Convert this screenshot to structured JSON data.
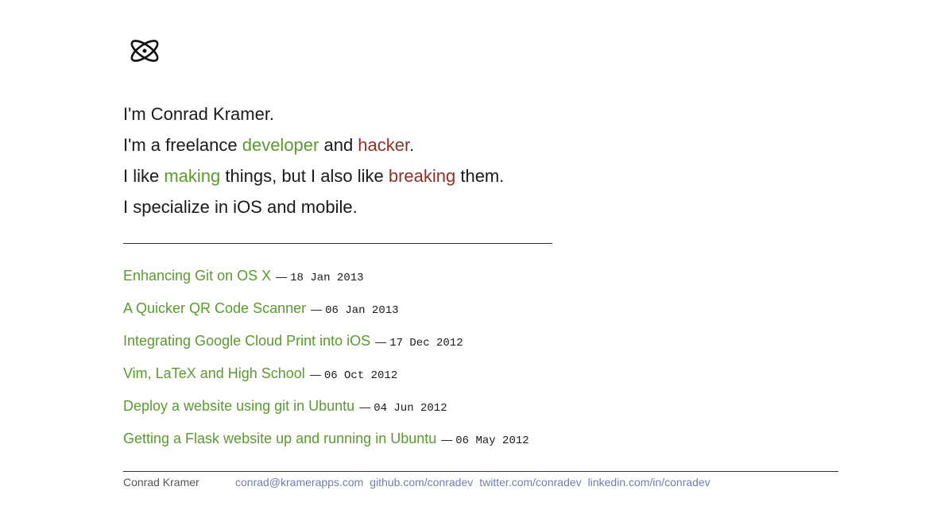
{
  "logo": {
    "icon": "atom-icon"
  },
  "intro": {
    "line1": "I'm Conrad Kramer.",
    "line2": {
      "prefix": "I'm a freelance ",
      "word1": "developer",
      "middle": " and ",
      "word2": "hacker",
      "suffix": "."
    },
    "line3": {
      "prefix": "I like ",
      "word1": "making",
      "middle": " things, but I also like ",
      "word2": "breaking",
      "suffix": " them."
    },
    "line4": "I specialize in iOS and mobile."
  },
  "posts": [
    {
      "title": "Enhancing Git on OS X",
      "sep": "—",
      "date": "18 Jan 2013"
    },
    {
      "title": "A Quicker QR Code Scanner",
      "sep": "—",
      "date": "06 Jan 2013"
    },
    {
      "title": "Integrating Google Cloud Print into iOS",
      "sep": "—",
      "date": "17 Dec 2012"
    },
    {
      "title": "Vim, LaTeX and High School",
      "sep": "—",
      "date": "06 Oct 2012"
    },
    {
      "title": "Deploy a website using git in Ubuntu",
      "sep": "—",
      "date": "04 Jun 2012"
    },
    {
      "title": "Getting a Flask website up and running in Ubuntu",
      "sep": "—",
      "date": "06 May 2012"
    }
  ],
  "footer": {
    "name": "Conrad Kramer",
    "email": "conrad@kramerapps.com",
    "github": "github.com/conradev",
    "twitter": "twitter.com/conradev",
    "linkedin": "linkedin.com/in/conradev"
  },
  "colors": {
    "green": "#5a9a2e",
    "red": "#8e3226",
    "footer_link": "#6e7fae"
  }
}
